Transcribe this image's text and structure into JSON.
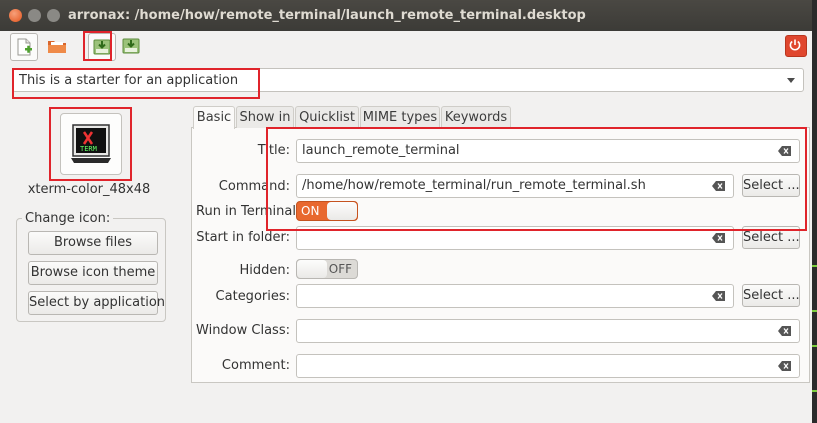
{
  "window": {
    "title": "arronax: /home/how/remote_terminal/launch_remote_terminal.desktop"
  },
  "toolbar": {
    "new_icon": "new-file-icon",
    "open_icon": "open-folder-icon",
    "save_icon": "save-icon",
    "save_as_icon": "save-as-icon",
    "quit_icon": "power-icon"
  },
  "starter_combo": {
    "value": "This is a starter for an application"
  },
  "icon_panel": {
    "icon_name": "xterm-color_48x48",
    "change_icon_label": "Change icon:",
    "browse_files": "Browse files",
    "browse_icon_theme": "Browse icon theme",
    "select_by_application": "Select by application"
  },
  "tabs": [
    {
      "label": "Basic",
      "active": true
    },
    {
      "label": "Show in",
      "active": false
    },
    {
      "label": "Quicklist",
      "active": false
    },
    {
      "label": "MIME types",
      "active": false
    },
    {
      "label": "Keywords",
      "active": false
    }
  ],
  "form": {
    "title": {
      "label": "Title:",
      "value": "launch_remote_terminal"
    },
    "command": {
      "label": "Command:",
      "value": "/home/how/remote_terminal/run_remote_terminal.sh",
      "select": "Select ..."
    },
    "run_in_terminal": {
      "label": "Run in Terminal:",
      "state": "ON"
    },
    "start_in_folder": {
      "label": "Start in folder:",
      "value": "",
      "select": "Select ..."
    },
    "hidden": {
      "label": "Hidden:",
      "state": "OFF"
    },
    "categories": {
      "label": "Categories:",
      "value": "",
      "select": "Select ..."
    },
    "window_class": {
      "label": "Window Class:",
      "value": ""
    },
    "comment": {
      "label": "Comment:",
      "value": ""
    }
  },
  "colors": {
    "accent": "#e8682f",
    "highlight": "#e0242b",
    "titlebar": "#3c3b37"
  }
}
